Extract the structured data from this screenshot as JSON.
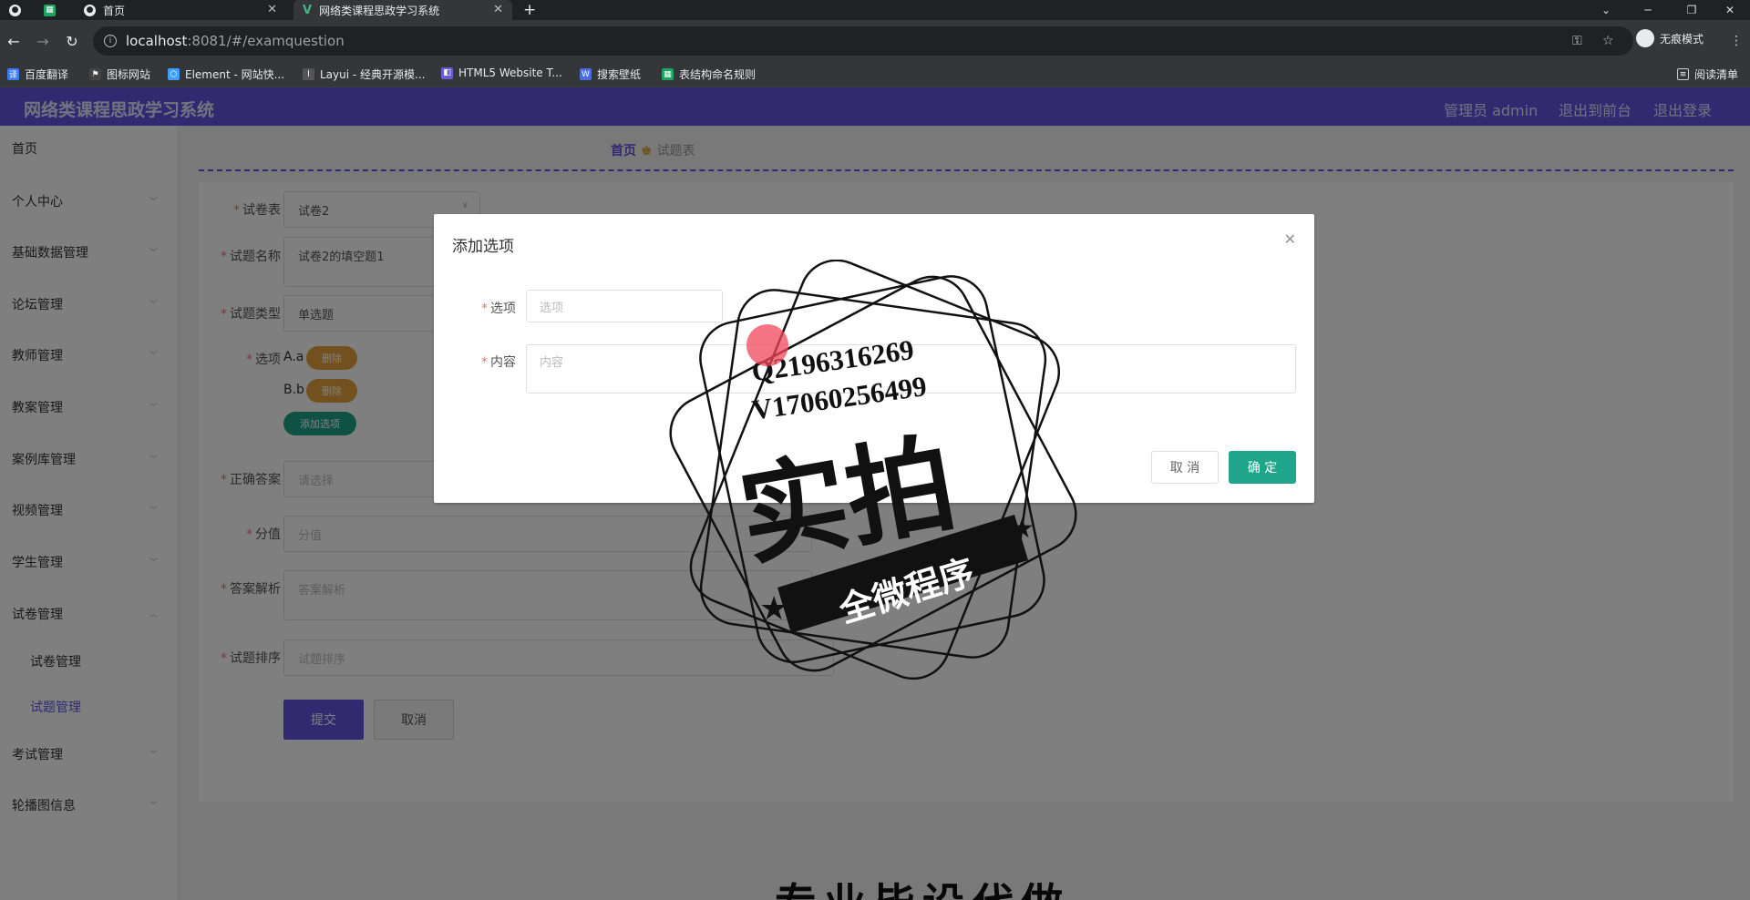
{
  "browser": {
    "tabs": [
      {
        "label": "首页"
      },
      {
        "label": "网络类课程思政学习系统"
      }
    ],
    "new_tab": "+",
    "url_host": "localhost",
    "url_path": ":8081/#/examquestion",
    "profile_label": "无痕模式",
    "bookmarks": [
      {
        "label": "百度翻译",
        "color": "#3b7cf5"
      },
      {
        "label": "图标网站",
        "color": "#444444"
      },
      {
        "label": "Element - 网站快...",
        "color": "#409eff"
      },
      {
        "label": "Layui - 经典开源模...",
        "color": "#555555"
      },
      {
        "label": "HTML5 Website T...",
        "color": "#6b5cd1"
      },
      {
        "label": "搜索壁纸",
        "color": "#4a6ee0"
      },
      {
        "label": "表结构命名规则",
        "color": "#1da462"
      }
    ],
    "reading_list": "阅读清单"
  },
  "app": {
    "title": "网络类课程思政学习系统",
    "header_links": [
      "管理员 admin",
      "退出到前台",
      "退出登录"
    ],
    "accent": "#6255e0"
  },
  "sidebar": {
    "items": [
      {
        "label": "首页"
      },
      {
        "label": "个人中心"
      },
      {
        "label": "基础数据管理"
      },
      {
        "label": "论坛管理"
      },
      {
        "label": "教师管理"
      },
      {
        "label": "教案管理"
      },
      {
        "label": "案例库管理"
      },
      {
        "label": "视频管理"
      },
      {
        "label": "学生管理"
      },
      {
        "label": "试卷管理"
      },
      {
        "label": "考试管理"
      },
      {
        "label": "轮播图信息"
      }
    ],
    "sub_items": [
      {
        "label": "试卷管理"
      },
      {
        "label": "试题管理"
      }
    ]
  },
  "breadcrumb": {
    "home": "首页",
    "current": "试题表"
  },
  "form": {
    "paper_label": "试卷表",
    "paper_value": "试卷2",
    "name_label": "试题名称",
    "name_value": "试卷2的填空题1",
    "type_label": "试题类型",
    "type_value": "单选题",
    "options_label": "选项",
    "options": [
      {
        "label": "A.a",
        "delete": "删除"
      },
      {
        "label": "B.b",
        "delete": "删除"
      }
    ],
    "add_option": "添加选项",
    "answer_label": "正确答案",
    "answer_placeholder": "请选择",
    "score_label": "分值",
    "score_placeholder": "分值",
    "analysis_label": "答案解析",
    "analysis_placeholder": "答案解析",
    "sort_label": "试题排序",
    "sort_placeholder": "试题排序",
    "submit": "提交",
    "cancel": "取消"
  },
  "dialog": {
    "title": "添加选项",
    "option_label": "选项",
    "option_placeholder": "选项",
    "content_label": "内容",
    "content_placeholder": "内容",
    "cancel": "取 消",
    "confirm": "确 定"
  },
  "watermark": {
    "line1": "Q2196316269",
    "line2": "V17060256499",
    "big": "实拍",
    "banner": "全微程序"
  },
  "bottom_caption": "专业毕设代做"
}
